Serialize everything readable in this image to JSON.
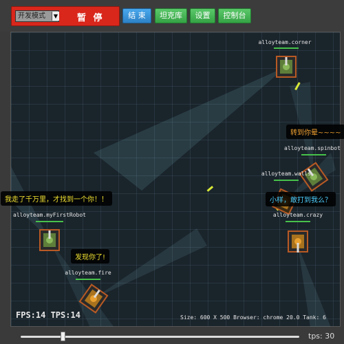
{
  "toolbar": {
    "mode_select_value": "开发模式",
    "pause_label": "暂 停",
    "end_label": "结 束",
    "tank_library_label": "坦克库",
    "settings_label": "设置",
    "console_label": "控制台"
  },
  "tanks": [
    {
      "name": "alloyteam.corner",
      "color": "green"
    },
    {
      "name": "alloyteam.spinbot",
      "color": "green"
    },
    {
      "name": "alloyteam.walls",
      "color": "orange"
    },
    {
      "name": "alloyteam.myFirstRobot",
      "color": "green"
    },
    {
      "name": "alloyteam.crazy",
      "color": "orange"
    },
    {
      "name": "alloyteam.fire",
      "color": "orange"
    }
  ],
  "bubbles": {
    "spinbot": "转到你晕~~~~",
    "myFirstRobot": "我走了千万里，才找到一个你！！",
    "crazy": "小样，敢打到我么？",
    "fire": "发现你了!"
  },
  "stats": {
    "fps_tps": "FPS:14 TPS:14",
    "info": "Size: 600 X 500   Browser: chrome 20.0   Tank: 6"
  },
  "bottom": {
    "tps_label": "tps: 30",
    "speed_value": 30
  },
  "colors": {
    "pause_button": "#d9271c",
    "blue_button": "#3593d9",
    "green_button": "#45b554",
    "hp_bar": "#47c24b",
    "arena_bg": "#1a242b",
    "bullet": "#d8e838"
  }
}
